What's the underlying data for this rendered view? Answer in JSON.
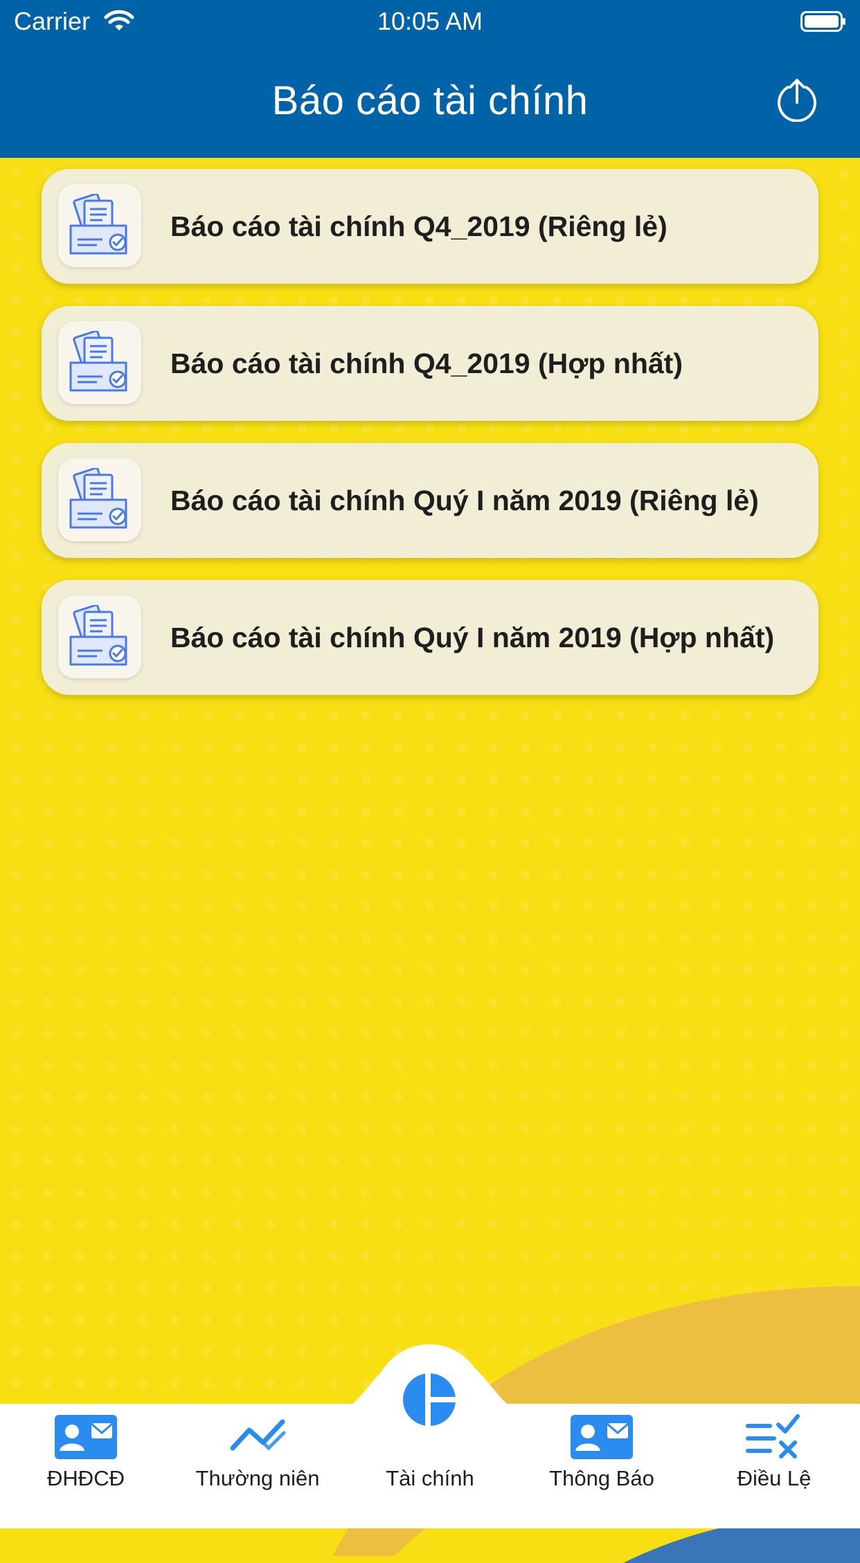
{
  "status_bar": {
    "carrier": "Carrier",
    "time": "10:05 AM"
  },
  "nav": {
    "title": "Báo cáo tài chính",
    "share_icon": "share-upload-icon"
  },
  "reports": [
    {
      "label": "Báo cáo tài chính Q4_2019 (Riêng lẻ)",
      "icon": "document-files-icon"
    },
    {
      "label": "Báo cáo tài chính Q4_2019 (Hợp nhất)",
      "icon": "document-files-icon"
    },
    {
      "label": "Báo cáo tài chính Quý I năm 2019 (Riêng lẻ)",
      "icon": "document-files-icon"
    },
    {
      "label": "Báo cáo tài chính Quý I năm 2019 (Hợp nhất)",
      "icon": "document-files-icon"
    }
  ],
  "tabs": [
    {
      "label": "ĐHĐCĐ",
      "icon": "contact-card-icon"
    },
    {
      "label": "Thường niên",
      "icon": "trend-chart-icon"
    },
    {
      "label": "Tài chính",
      "icon": "pie-chart-icon",
      "selected": true
    },
    {
      "label": "Thông Báo",
      "icon": "contact-card-icon"
    },
    {
      "label": "Điều Lệ",
      "icon": "checklist-icon"
    }
  ],
  "colors": {
    "header": "#0063A8",
    "background": "#F7DF14",
    "card": "#F2EDD5",
    "accent": "#2A8BF0",
    "wave_orange": "#ECB848",
    "wave_blue": "#3A75B8"
  }
}
